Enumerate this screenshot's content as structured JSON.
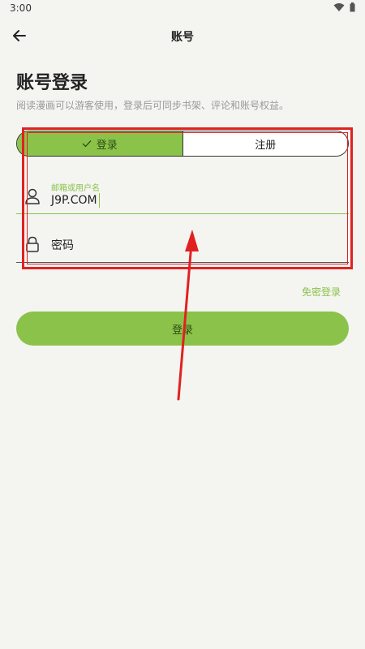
{
  "status_bar": {
    "time": "3:00"
  },
  "appbar": {
    "title": "账号"
  },
  "header": {
    "title": "账号登录",
    "subtitle": "阅读漫画可以游客使用，登录后可同步书架、评论和账号权益。"
  },
  "tabs": {
    "login": "登录",
    "register": "注册"
  },
  "form": {
    "username_label": "邮箱或用户名",
    "username_value": "J9P.COM",
    "password_placeholder": "密码"
  },
  "links": {
    "passwordless_login": "免密登录"
  },
  "buttons": {
    "login": "登录"
  },
  "colors": {
    "accent": "#8bc34a",
    "annotation": "#e12121",
    "background": "#f4f4f1"
  }
}
